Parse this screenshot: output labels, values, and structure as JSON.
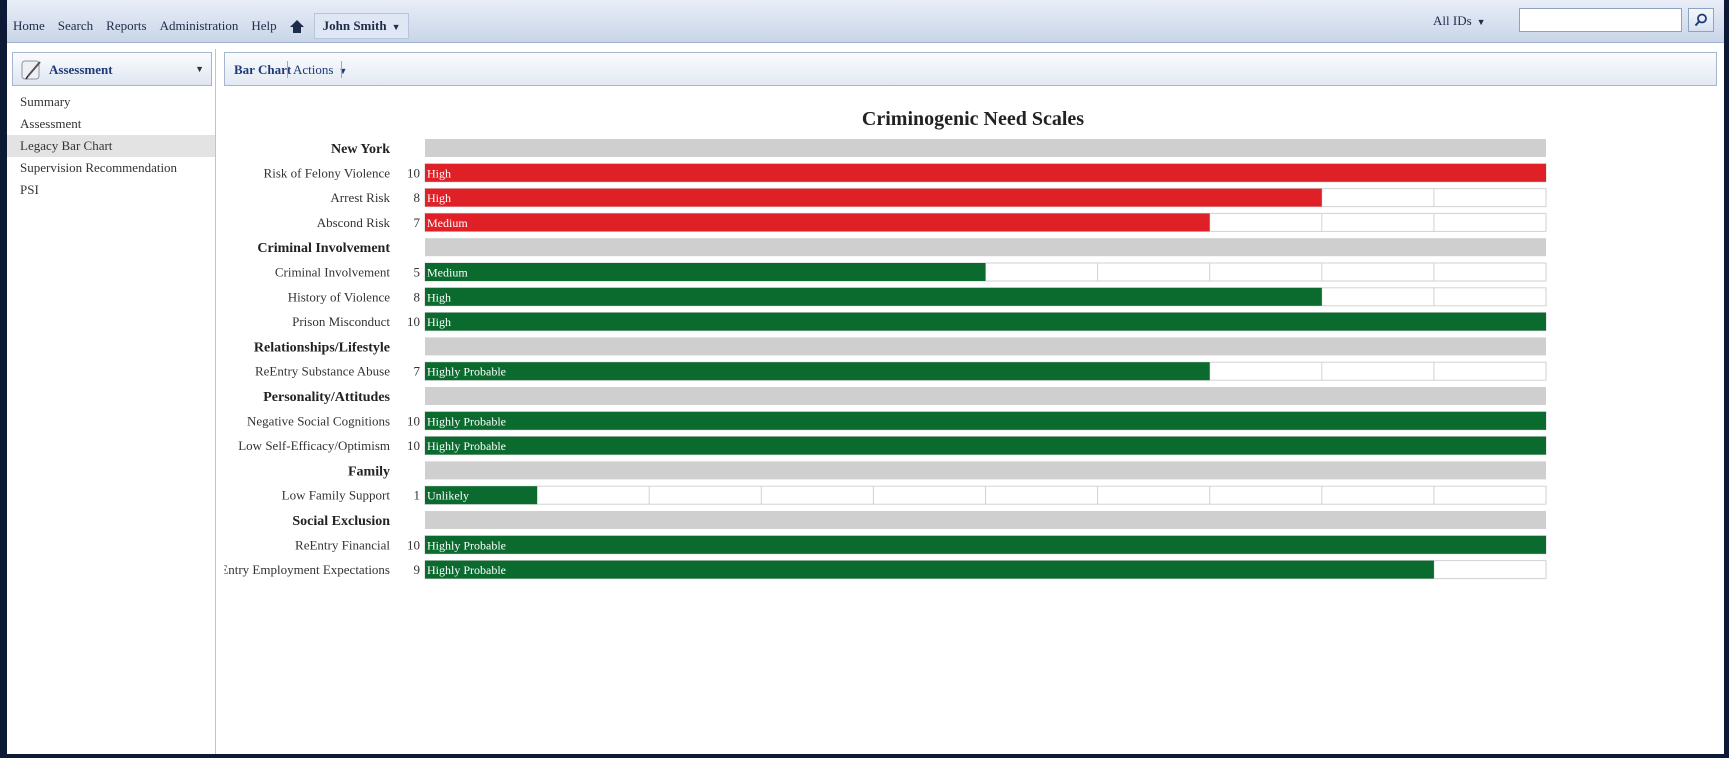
{
  "topbar": {
    "nav": [
      "Home",
      "Search",
      "Reports",
      "Administration",
      "Help"
    ],
    "user": "John Smith",
    "id_select": "All IDs",
    "search_value": ""
  },
  "sidebar": {
    "header": "Assessment",
    "items": [
      {
        "label": "Summary",
        "active": false
      },
      {
        "label": "Assessment",
        "active": false
      },
      {
        "label": "Legacy Bar Chart",
        "active": true
      },
      {
        "label": "Supervision Recommendation",
        "active": false
      },
      {
        "label": "PSI",
        "active": false
      }
    ]
  },
  "toolbar": {
    "chart_label": "Bar Chart",
    "actions_label": "Actions"
  },
  "colors": {
    "high": "#e02027",
    "low": "#0b6b2f",
    "group_bg": "#cfcfcf",
    "grid": "#d2d2d2"
  },
  "chart_data": {
    "type": "bar",
    "title": "Criminogenic Need Scales",
    "xlim": [
      0,
      10
    ],
    "grid": true,
    "rows": [
      {
        "kind": "group",
        "label": "New York"
      },
      {
        "kind": "bar",
        "label": "Risk of Felony Violence",
        "value": 10,
        "level": "High",
        "color": "red"
      },
      {
        "kind": "bar",
        "label": "Arrest Risk",
        "value": 8,
        "level": "High",
        "color": "red"
      },
      {
        "kind": "bar",
        "label": "Abscond Risk",
        "value": 7,
        "level": "Medium",
        "color": "red"
      },
      {
        "kind": "group",
        "label": "Criminal Involvement"
      },
      {
        "kind": "bar",
        "label": "Criminal Involvement",
        "value": 5,
        "level": "Medium",
        "color": "green"
      },
      {
        "kind": "bar",
        "label": "History of Violence",
        "value": 8,
        "level": "High",
        "color": "green"
      },
      {
        "kind": "bar",
        "label": "Prison Misconduct",
        "value": 10,
        "level": "High",
        "color": "green"
      },
      {
        "kind": "group",
        "label": "Relationships/Lifestyle"
      },
      {
        "kind": "bar",
        "label": "ReEntry Substance Abuse",
        "value": 7,
        "level": "Highly Probable",
        "color": "green"
      },
      {
        "kind": "group",
        "label": "Personality/Attitudes"
      },
      {
        "kind": "bar",
        "label": "Negative Social Cognitions",
        "value": 10,
        "level": "Highly Probable",
        "color": "green"
      },
      {
        "kind": "bar",
        "label": "Low Self-Efficacy/Optimism",
        "value": 10,
        "level": "Highly Probable",
        "color": "green"
      },
      {
        "kind": "group",
        "label": "Family"
      },
      {
        "kind": "bar",
        "label": "Low Family Support",
        "value": 1,
        "level": "Unlikely",
        "color": "green"
      },
      {
        "kind": "group",
        "label": "Social Exclusion"
      },
      {
        "kind": "bar",
        "label": "ReEntry Financial",
        "value": 10,
        "level": "Highly Probable",
        "color": "green"
      },
      {
        "kind": "bar",
        "label": "ReEntry Employment Expectations",
        "value": 9,
        "level": "Highly Probable",
        "color": "green"
      }
    ]
  }
}
